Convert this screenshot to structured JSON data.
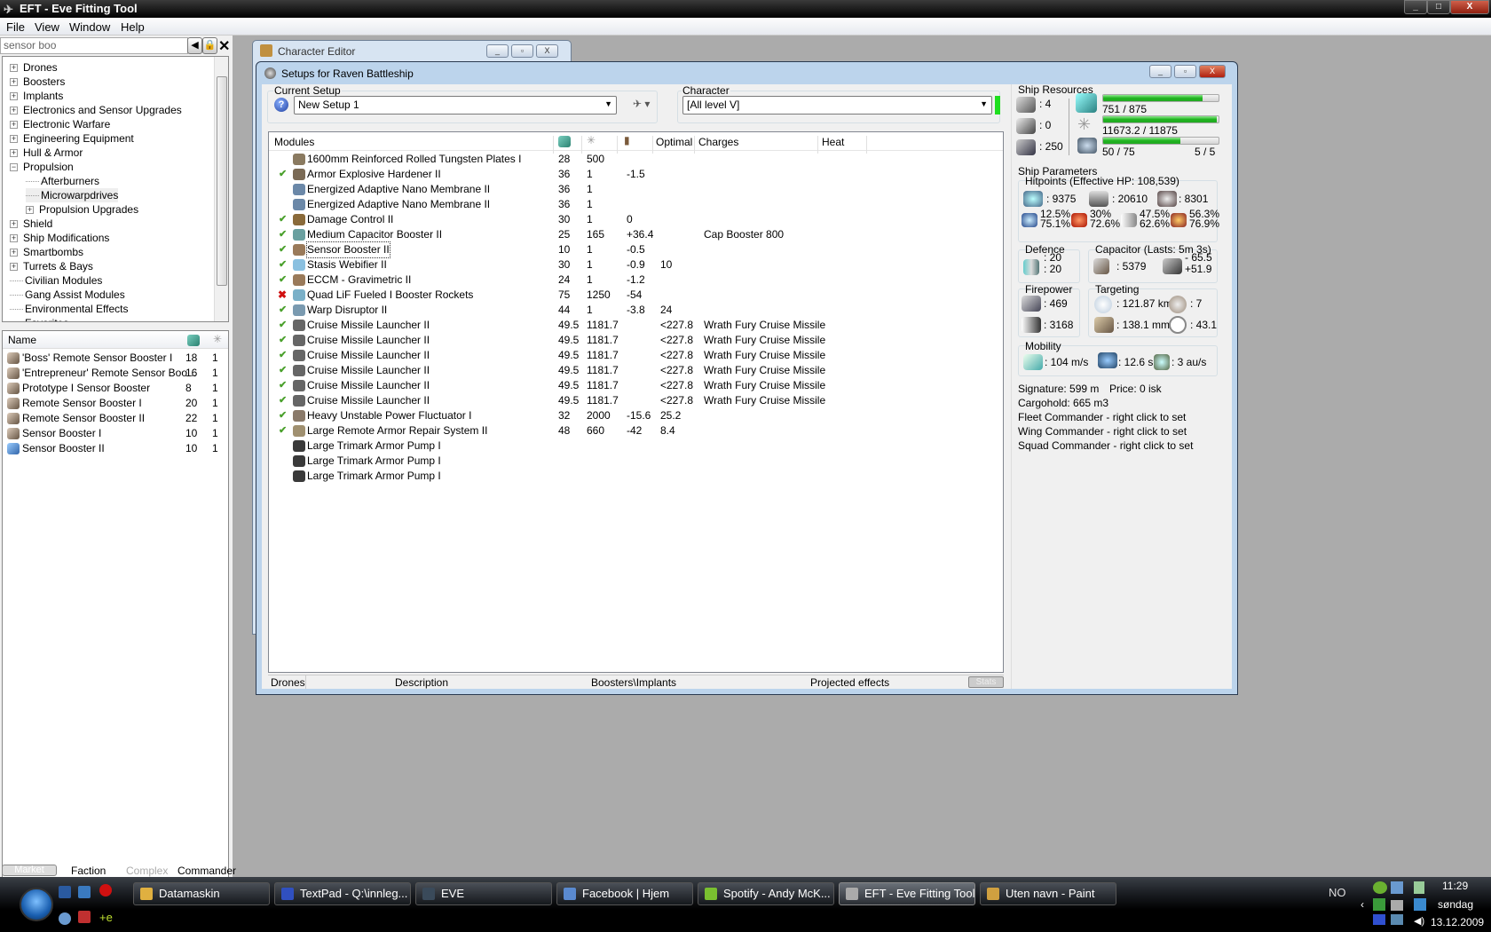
{
  "app": {
    "title": "EFT - Eve Fitting Tool",
    "window_buttons": [
      "_",
      "□",
      "X"
    ]
  },
  "menu": [
    "File",
    "View",
    "Window",
    "Help"
  ],
  "left": {
    "search_value": "sensor boo",
    "tree": [
      {
        "label": "Drones",
        "expander": "+",
        "level": 0
      },
      {
        "label": "Boosters",
        "expander": "+",
        "level": 0
      },
      {
        "label": "Implants",
        "expander": "+",
        "level": 0
      },
      {
        "label": "Electronics and Sensor Upgrades",
        "expander": "+",
        "level": 0
      },
      {
        "label": "Electronic Warfare",
        "expander": "+",
        "level": 0
      },
      {
        "label": "Engineering Equipment",
        "expander": "+",
        "level": 0
      },
      {
        "label": "Hull & Armor",
        "expander": "+",
        "level": 0
      },
      {
        "label": "Propulsion",
        "expander": "−",
        "level": 0
      },
      {
        "label": "Afterburners",
        "expander": "",
        "level": 1
      },
      {
        "label": "Microwarpdrives",
        "expander": "",
        "level": 1
      },
      {
        "label": "Propulsion Upgrades",
        "expander": "+",
        "level": 1
      },
      {
        "label": "Shield",
        "expander": "+",
        "level": 0
      },
      {
        "label": "Ship Modifications",
        "expander": "+",
        "level": 0
      },
      {
        "label": "Smartbombs",
        "expander": "+",
        "level": 0
      },
      {
        "label": "Turrets & Bays",
        "expander": "+",
        "level": 0
      },
      {
        "label": "Civilian Modules",
        "expander": "",
        "level": 0
      },
      {
        "label": "Gang Assist Modules",
        "expander": "",
        "level": 0
      },
      {
        "label": "Environmental Effects",
        "expander": "",
        "level": 0
      },
      {
        "label": "Favorites",
        "expander": "",
        "level": 0
      }
    ],
    "list_header": "Name",
    "items": [
      {
        "name": "'Boss' Remote Sensor Booster I",
        "cpu": "18",
        "pg": "1"
      },
      {
        "name": "'Entrepreneur' Remote Sensor Boo...",
        "cpu": "16",
        "pg": "1"
      },
      {
        "name": "Prototype I Sensor Booster",
        "cpu": "8",
        "pg": "1"
      },
      {
        "name": "Remote Sensor Booster I",
        "cpu": "20",
        "pg": "1"
      },
      {
        "name": "Remote Sensor Booster II",
        "cpu": "22",
        "pg": "1"
      },
      {
        "name": "Sensor Booster I",
        "cpu": "10",
        "pg": "1"
      },
      {
        "name": "Sensor Booster II",
        "cpu": "10",
        "pg": "1"
      }
    ],
    "tabs": [
      "Market",
      "Faction",
      "Complex",
      "Commander"
    ]
  },
  "char_editor": {
    "title": "Character Editor"
  },
  "setup": {
    "title": "Setups for Raven Battleship",
    "current_setup_label": "Current Setup",
    "current_setup_value": "New Setup 1",
    "character_label": "Character",
    "character_value": "[All level V]",
    "headers": {
      "modules": "Modules",
      "optimal": "Optimal",
      "charges": "Charges",
      "heat": "Heat"
    },
    "modules": [
      {
        "state": "",
        "name": "1600mm Reinforced Rolled Tungsten Plates I",
        "cpu": "28",
        "pg": "500",
        "cap": "",
        "optimal": "",
        "charge": "",
        "icon": "#8a7a60"
      },
      {
        "state": "on",
        "name": "Armor Explosive Hardener II",
        "cpu": "36",
        "pg": "1",
        "cap": "-1.5",
        "optimal": "",
        "charge": "",
        "icon": "#7a6a55"
      },
      {
        "state": "",
        "name": "Energized Adaptive Nano Membrane II",
        "cpu": "36",
        "pg": "1",
        "cap": "",
        "optimal": "",
        "charge": "",
        "icon": "#6b88a8"
      },
      {
        "state": "",
        "name": "Energized Adaptive Nano Membrane II",
        "cpu": "36",
        "pg": "1",
        "cap": "",
        "optimal": "",
        "charge": "",
        "icon": "#6b88a8"
      },
      {
        "state": "on",
        "name": "Damage Control II",
        "cpu": "30",
        "pg": "1",
        "cap": "0",
        "optimal": "",
        "charge": "",
        "icon": "#8a6a3a"
      },
      {
        "state": "on",
        "name": "Medium Capacitor Booster II",
        "cpu": "25",
        "pg": "165",
        "cap": "+36.4",
        "optimal": "",
        "charge": "Cap Booster 800",
        "icon": "#6aa0a0"
      },
      {
        "state": "on",
        "name": "Sensor Booster II",
        "cpu": "10",
        "pg": "1",
        "cap": "-0.5",
        "optimal": "",
        "charge": "",
        "icon": "#9a7a5a",
        "focus": true
      },
      {
        "state": "on",
        "name": "Stasis Webifier II",
        "cpu": "30",
        "pg": "1",
        "cap": "-0.9",
        "optimal": "10",
        "charge": "",
        "icon": "#8ac0e0"
      },
      {
        "state": "on",
        "name": "ECCM - Gravimetric II",
        "cpu": "24",
        "pg": "1",
        "cap": "-1.2",
        "optimal": "",
        "charge": "",
        "icon": "#9a7a5a"
      },
      {
        "state": "off",
        "name": "Quad LiF Fueled I Booster Rockets",
        "cpu": "75",
        "pg": "1250",
        "cap": "-54",
        "optimal": "",
        "charge": "",
        "icon": "#7ab0c8"
      },
      {
        "state": "on",
        "name": "Warp Disruptor II",
        "cpu": "44",
        "pg": "1",
        "cap": "-3.8",
        "optimal": "24",
        "charge": "",
        "icon": "#7a9ab0"
      },
      {
        "state": "on",
        "name": "Cruise Missile Launcher II",
        "cpu": "49.5",
        "pg": "1181.7",
        "cap": "",
        "optimal": "<227.8",
        "charge": "Wrath Fury Cruise Missile",
        "icon": "#666"
      },
      {
        "state": "on",
        "name": "Cruise Missile Launcher II",
        "cpu": "49.5",
        "pg": "1181.7",
        "cap": "",
        "optimal": "<227.8",
        "charge": "Wrath Fury Cruise Missile",
        "icon": "#666"
      },
      {
        "state": "on",
        "name": "Cruise Missile Launcher II",
        "cpu": "49.5",
        "pg": "1181.7",
        "cap": "",
        "optimal": "<227.8",
        "charge": "Wrath Fury Cruise Missile",
        "icon": "#666"
      },
      {
        "state": "on",
        "name": "Cruise Missile Launcher II",
        "cpu": "49.5",
        "pg": "1181.7",
        "cap": "",
        "optimal": "<227.8",
        "charge": "Wrath Fury Cruise Missile",
        "icon": "#666"
      },
      {
        "state": "on",
        "name": "Cruise Missile Launcher II",
        "cpu": "49.5",
        "pg": "1181.7",
        "cap": "",
        "optimal": "<227.8",
        "charge": "Wrath Fury Cruise Missile",
        "icon": "#666"
      },
      {
        "state": "on",
        "name": "Cruise Missile Launcher II",
        "cpu": "49.5",
        "pg": "1181.7",
        "cap": "",
        "optimal": "<227.8",
        "charge": "Wrath Fury Cruise Missile",
        "icon": "#666"
      },
      {
        "state": "on",
        "name": "Heavy Unstable Power Fluctuator I",
        "cpu": "32",
        "pg": "2000",
        "cap": "-15.6",
        "optimal": "25.2",
        "charge": "",
        "icon": "#8a7a6a"
      },
      {
        "state": "on",
        "name": "Large Remote Armor Repair System II",
        "cpu": "48",
        "pg": "660",
        "cap": "-42",
        "optimal": "8.4",
        "charge": "",
        "icon": "#a09070"
      },
      {
        "state": "",
        "name": "Large Trimark Armor Pump I",
        "cpu": "",
        "pg": "",
        "cap": "",
        "optimal": "",
        "charge": "",
        "icon": "#3a3a3a"
      },
      {
        "state": "",
        "name": "Large Trimark Armor Pump I",
        "cpu": "",
        "pg": "",
        "cap": "",
        "optimal": "",
        "charge": "",
        "icon": "#3a3a3a"
      },
      {
        "state": "",
        "name": "Large Trimark Armor Pump I",
        "cpu": "",
        "pg": "",
        "cap": "",
        "optimal": "",
        "charge": "",
        "icon": "#3a3a3a"
      }
    ],
    "bottom_tabs": [
      "Drones",
      "Description",
      "Boosters\\Implants",
      "Projected effects",
      "Stats"
    ]
  },
  "stats": {
    "resources_label": "Ship Resources",
    "hardpoints": {
      "turrets": ": 4",
      "launchers": ": 0",
      "drone_bay": ": 250"
    },
    "cpu": {
      "text": "751 / 875",
      "fraction": 0.858
    },
    "powergrid": {
      "text": "11673.2 / 11875",
      "fraction": 0.983
    },
    "drone_bandwidth": {
      "text": "50 / 75",
      "fraction": 0.667,
      "drones": "5 / 5"
    },
    "params_label": "Ship Parameters",
    "hitpoints_label": "Hitpoints (Effective HP: 108,539)",
    "shield_hp": ": 9375",
    "armor_hp": ": 20610",
    "structure_hp": ": 8301",
    "resists": [
      {
        "type": "em",
        "a": "12.5%",
        "b": "75.1%"
      },
      {
        "type": "thermal",
        "a": "30%",
        "b": "72.6%"
      },
      {
        "type": "kinetic",
        "a": "47.5%",
        "b": "62.6%"
      },
      {
        "type": "explosive",
        "a": "56.3%",
        "b": "76.9%"
      }
    ],
    "defence_label": "Defence",
    "defence_a": ": 20",
    "defence_b": ": 20",
    "capacitor_label": "Capacitor (Lasts: 5m 3s)",
    "cap_amount": ": 5379",
    "cap_use": "- 65.5",
    "cap_recharge": "+51.9",
    "firepower_label": "Firepower",
    "dps": ": 469",
    "volley": ": 3168",
    "targeting_label": "Targeting",
    "range": ": 121.87 km",
    "max_targets": ": 7",
    "scan_res": ": 138.1 mm",
    "sensor_strength": ": 43.1",
    "mobility_label": "Mobility",
    "speed": ": 104 m/s",
    "align": ": 12.6 s",
    "warp": ": 3 au/s",
    "signature": "Signature: 599 m",
    "price": "Price: 0 isk",
    "cargo": "Cargohold: 665 m3",
    "fleet": "Fleet Commander - right click to set",
    "wing": "Wing Commander - right click to set",
    "squad": "Squad Commander - right click to set"
  },
  "taskbar": {
    "buttons": [
      {
        "label": "Datamaskin",
        "color": "#e0b040"
      },
      {
        "label": "TextPad - Q:\\innleg...",
        "color": "#3050c0"
      },
      {
        "label": "EVE",
        "color": "#3a4a5a"
      },
      {
        "label": "Facebook | Hjem",
        "color": "#5a8ad0"
      },
      {
        "label": "Spotify - Andy McK...",
        "color": "#7ac030"
      },
      {
        "label": "EFT - Eve Fitting Tool",
        "color": "#aaaaaa",
        "active": true
      },
      {
        "label": "Uten navn - Paint",
        "color": "#d0a040"
      }
    ],
    "lang": "NO",
    "time": "11:29",
    "day": "søndag",
    "date": "13.12.2009"
  },
  "colors": {
    "accent_green": "#1fb41f",
    "mdi_bg": "#ababab",
    "check": "#4aa02c",
    "error": "#d01010"
  }
}
